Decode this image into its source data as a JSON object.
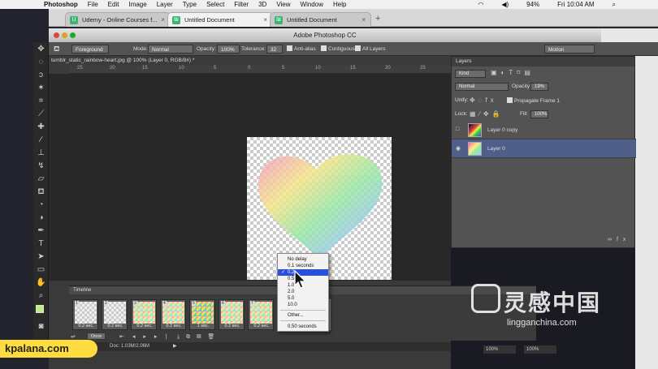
{
  "menubar": {
    "app": "Photoshop",
    "items": [
      "File",
      "Edit",
      "Image",
      "Layer",
      "Type",
      "Select",
      "Filter",
      "3D",
      "View",
      "Window",
      "Help"
    ],
    "battery": "94%",
    "clock": "Fri 10:04 AM"
  },
  "browser": {
    "tabs": [
      {
        "label": "Udemy - Online Courses f...",
        "active": false
      },
      {
        "label": "Untitled Document",
        "active": true
      },
      {
        "label": "Untitled Document",
        "active": false
      }
    ]
  },
  "ps": {
    "window_title": "Adobe Photoshop CC",
    "options": {
      "tool_mode": "Foreground",
      "mode_label": "Mode:",
      "mode_value": "Normal",
      "opacity_label": "Opacity:",
      "opacity_value": "100%",
      "tolerance_label": "Tolerance:",
      "tolerance_value": "32",
      "antialias_label": "Anti-alias",
      "contiguous_label": "Contiguous",
      "alllayers_label": "All Layers",
      "workspace": "Motion"
    },
    "doc_tab": "tumblr_static_rainbow-heart.jpg @ 100% (Layer 0, RGB/8#) *",
    "ruler_ticks": [
      "25",
      "20",
      "15",
      "10",
      "5",
      "0",
      "5",
      "10",
      "15",
      "20",
      "25"
    ],
    "status": "Doc: 1.03M/2.06M"
  },
  "layers_panel": {
    "title": "Layers",
    "filter": "Kind",
    "blend": "Normal",
    "opacity_label": "Opacity:",
    "opacity_value": "19%",
    "unify_label": "Unify:",
    "propagate_label": "Propagate Frame 1",
    "lock_label": "Lock:",
    "fill_label": "Fill:",
    "fill_value": "100%",
    "layers": [
      {
        "name": "Layer 0 copy",
        "visible": false,
        "selected": false
      },
      {
        "name": "Layer 0",
        "visible": true,
        "selected": true
      }
    ]
  },
  "timeline": {
    "title": "Timeline",
    "loop": "Once",
    "frames": [
      {
        "n": "1",
        "delay": "0.2 sec."
      },
      {
        "n": "2",
        "delay": "0.2 sec."
      },
      {
        "n": "3",
        "delay": "0.2 sec."
      },
      {
        "n": "4",
        "delay": "0.2 sec."
      },
      {
        "n": "5",
        "delay": "1 sec."
      },
      {
        "n": "6",
        "delay": "0.2 sec."
      },
      {
        "n": "7",
        "delay": "0.2 sec."
      }
    ]
  },
  "delay_menu": {
    "items": [
      "No delay",
      "0.1 seconds",
      "0.2",
      "0.5",
      "1.0",
      "2.0",
      "5.0",
      "10.0",
      "Other...",
      "0.50 seconds"
    ],
    "highlighted": 2,
    "checked": 2
  },
  "right_panel": {
    "value1": "100%",
    "value2": "100%"
  },
  "branding": {
    "badge": "kpalana.com",
    "cn": "灵感中国",
    "en": "lingganchina.com"
  },
  "colors": {
    "accent": "#2a4fd8",
    "badge": "#ffdc3f"
  }
}
